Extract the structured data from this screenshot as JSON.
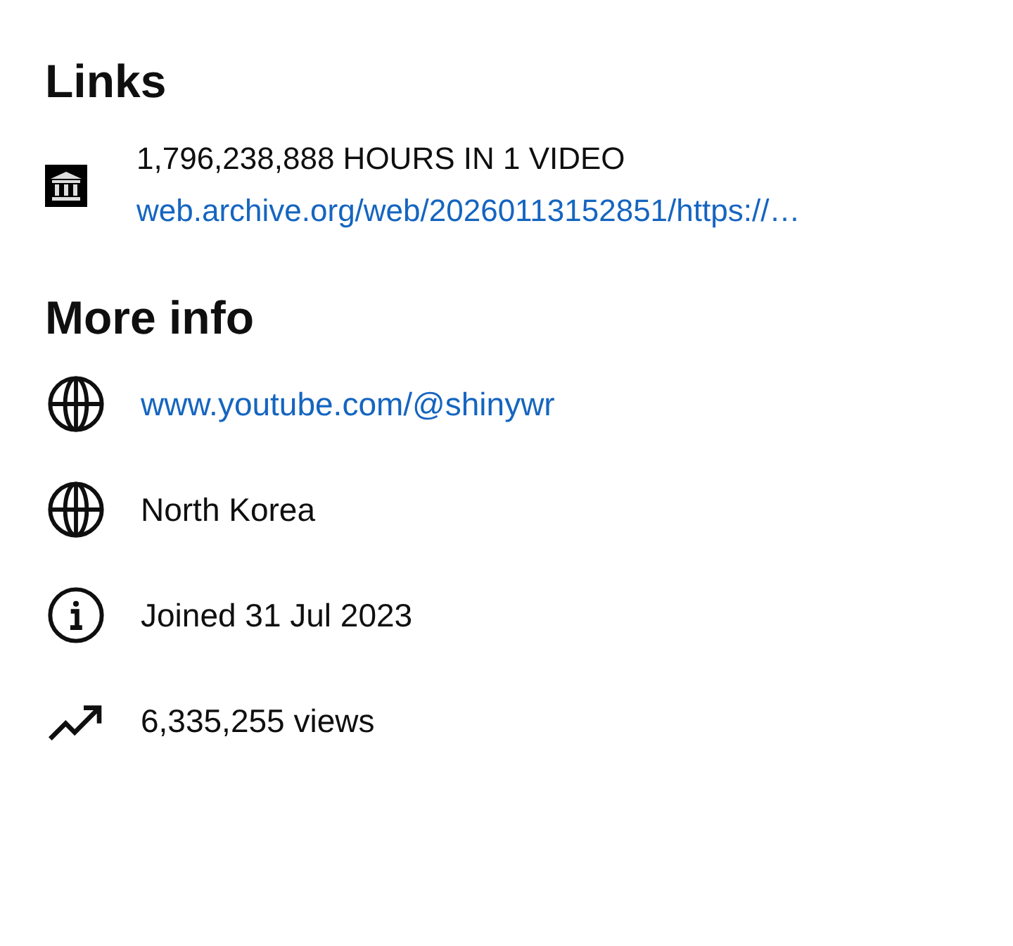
{
  "links": {
    "heading": "Links",
    "items": [
      {
        "title": "1,796,238,888 HOURS IN 1 VIDEO",
        "url": "web.archive.org/web/20260113152851/https://…"
      }
    ]
  },
  "more_info": {
    "heading": "More info",
    "items": [
      {
        "kind": "globe",
        "text": "www.youtube.com/@shinywr",
        "link": true
      },
      {
        "kind": "globe",
        "text": "North Korea",
        "link": false
      },
      {
        "kind": "info",
        "text": "Joined 31 Jul 2023",
        "link": false
      },
      {
        "kind": "trend",
        "text": "6,335,255 views",
        "link": false
      }
    ]
  }
}
